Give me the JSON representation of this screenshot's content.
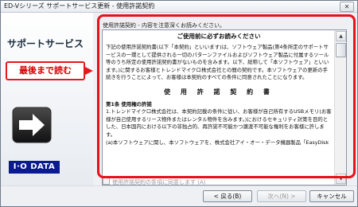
{
  "window": {
    "title": "ED-Vシリーズ サポートサービス更新 - 使用許諾契約",
    "close_label": "✕"
  },
  "sidebar": {
    "title": "サポートサービス",
    "brand_logo": "I·O DATA"
  },
  "callout": {
    "text": "最後まで読む"
  },
  "content": {
    "instruction": "使用許諾契約 - 内容を注意深くお読みください。",
    "license": {
      "heading": "ご使用前に必ずお読みください",
      "intro": "下記の使用許諾契約書(以下「本契約」といいます)は、ソフトウェア製品(第4条所定のサポートサービスの一環として提供される一切のパターンファイルおよびソフトウェア製品に付属するツール等のうち所定の使用許諾契約書がないものを含みます。以下、総称して「本ソフトウェア」といいます。)に関するお客様とトレンドマイクロ株式会社との間の契約です。本ソフトウェアの更新の手続きを行うことによって、お客様は本契約のすべての条件に同意されたことになります。",
      "contract_title": "使 用 許 諾 契 約 書",
      "article_title": "第1条 使用権の許諾",
      "item1": "1.トレンドマイクロ株式会社は、本契約記載の条件に従い、お客様が自己所有するUSBメモリ(お客様が自己使用するリース物件またはレンタル物件を含みます。)におけるセキュリティ対策を目的とした、日本国内における以下の非独占的、再許諾不可能かつ譲渡不可能な権利をお客様に許します。",
      "item2": "(a)本ソフトウェアに関し、本ソフトウェアを、株式会社アイ・オー・データ機器製品「EasyDisk"
    },
    "scroll_up": "▲",
    "scroll_down": "▼",
    "agree_label": "使用許諾契約の条項に同意します (A)"
  },
  "buttons": {
    "back": "< 戻る(B)",
    "next": "次へ(N) >",
    "cancel": "キャンセル"
  }
}
